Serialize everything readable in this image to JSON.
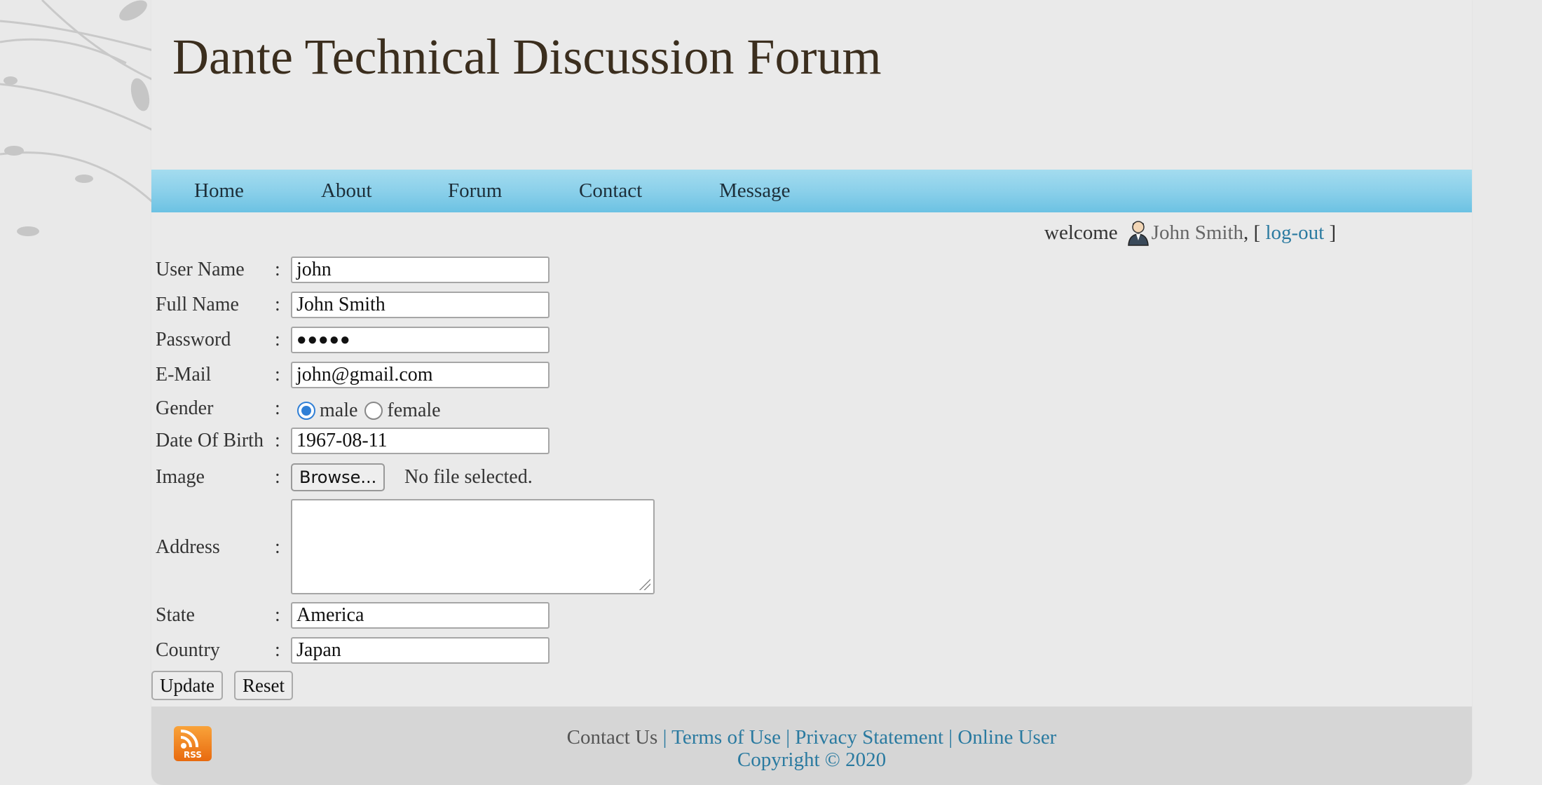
{
  "header": {
    "title": "Dante Technical Discussion Forum"
  },
  "nav": [
    "Home",
    "About",
    "Forum",
    "Contact",
    "Message"
  ],
  "welcome": {
    "prefix": "welcome",
    "user": "John Smith",
    "sep": ", [",
    "logout": "log-out",
    "close": "]"
  },
  "form": {
    "username": {
      "label": "User Name",
      "value": "john"
    },
    "fullname": {
      "label": "Full Name",
      "value": "John Smith"
    },
    "password": {
      "label": "Password",
      "value": "●●●●●"
    },
    "email": {
      "label": "E-Mail",
      "value": "john@gmail.com"
    },
    "gender": {
      "label": "Gender",
      "opt1": "male",
      "opt2": "female",
      "selected": "male"
    },
    "dob": {
      "label": "Date Of Birth",
      "value": "1967-08-11"
    },
    "image": {
      "label": "Image",
      "browse": "Browse...",
      "status": "No file selected."
    },
    "address": {
      "label": "Address",
      "value": ""
    },
    "state": {
      "label": "State",
      "value": "America"
    },
    "country": {
      "label": "Country",
      "value": "Japan"
    },
    "colon": ":",
    "update": "Update",
    "reset": "Reset"
  },
  "footer": {
    "rss": "RSS",
    "contact": "Contact Us",
    "sep": " | ",
    "terms": "Terms of Use",
    "privacy": "Privacy Statement",
    "online": "Online User",
    "copyright": "Copyright © 2020"
  },
  "colors": {
    "nav": "#8bd0ea",
    "link": "#2a7aa0",
    "title": "#3b2e1e"
  }
}
